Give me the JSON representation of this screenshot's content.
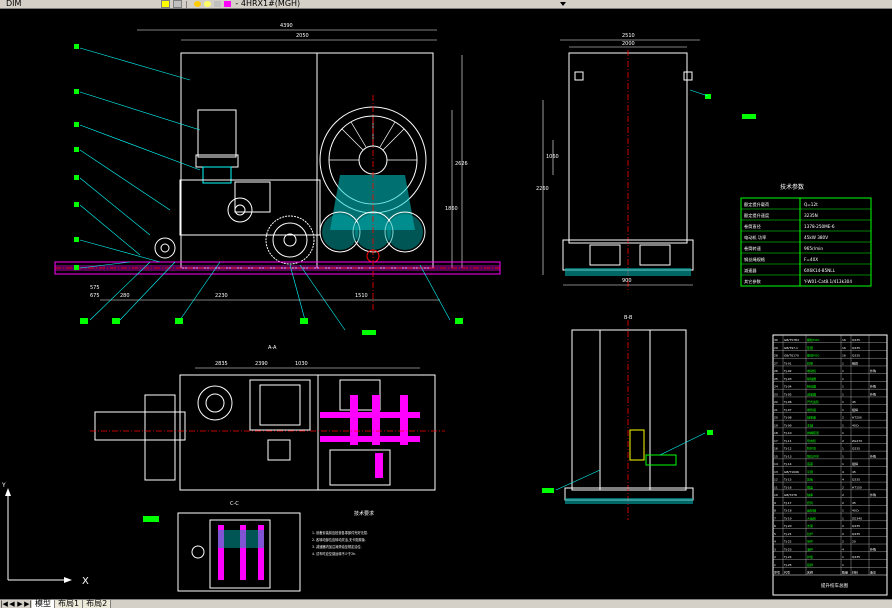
{
  "toolbar": {
    "left_text": "DIM",
    "title_text": "- 4HRX1#(MGH)"
  },
  "tabs": {
    "items": [
      "模型",
      "布局1",
      "布局2"
    ],
    "nav": [
      "|◀",
      "◀",
      "▶",
      "▶|"
    ]
  },
  "ucs": {
    "x_label": "X",
    "y_label": "Y"
  },
  "dimensions": {
    "front_overall": "4390",
    "front_sub": "2050",
    "front_height": "2626",
    "front_height2": "1860",
    "front_base_a": "280",
    "front_base_b": "2230",
    "front_base_c": "1510",
    "front_base_d": "575",
    "front_base_e": "675",
    "side_top": "2510",
    "side_top2": "2000",
    "side_height": "2260",
    "side_height2": "1060",
    "side_base": "900",
    "plan_a": "2835",
    "plan_b": "2390",
    "plan_c": "1030"
  },
  "section_labels": {
    "plan": "A-A",
    "section_bb": "B-B",
    "detail_c": "C-C"
  },
  "spec_table": {
    "title": "技术参数",
    "rows": [
      [
        "额定提升载荷",
        "Q=12t"
      ],
      [
        "额定提升速度",
        "3235N"
      ],
      [
        "卷筒直径",
        "1378-250ME-6"
      ],
      [
        "电动机 功率",
        "45kW  380V"
      ],
      [
        "卷筒转速",
        "965r/min"
      ],
      [
        "钢丝绳规格",
        "F=40X"
      ],
      [
        "减速器",
        "6X6K14-85NLL"
      ],
      [
        "其它参数",
        "Y-W01-Cat8.1/413k304"
      ]
    ]
  },
  "notes": {
    "title": "技术要求",
    "lines": [
      "1. 设备安装前应检查各零部件完好无损.",
      "2. 各转动部位应转动灵活,无卡阻现象.",
      "3. 减速器内加注润滑油至规定油位.",
      "4. 试车时应空载运转不少于2h."
    ]
  },
  "parts_list": {
    "header": [
      "序号",
      "代号",
      "名称",
      "数量",
      "材料",
      "备注"
    ],
    "rows": [
      [
        "30",
        "GB/T5783",
        "螺栓M20",
        "16",
        "Q235",
        ""
      ],
      [
        "29",
        "GB/T97.1",
        "垫圈",
        "16",
        "Q235",
        ""
      ],
      [
        "28",
        "GB/T6170",
        "螺母M20",
        "16",
        "Q235",
        ""
      ],
      [
        "27",
        "TJ-01",
        "机架",
        "1",
        "组焊",
        ""
      ],
      [
        "26",
        "TJ-02",
        "电动机",
        "1",
        "",
        "外购"
      ],
      [
        "25",
        "TJ-03",
        "联轴器",
        "1",
        "",
        ""
      ],
      [
        "24",
        "TJ-04",
        "制动器",
        "1",
        "",
        "外购"
      ],
      [
        "23",
        "TJ-05",
        "减速器",
        "1",
        "",
        "外购"
      ],
      [
        "22",
        "TJ-06",
        "开式齿轮",
        "1",
        "45",
        ""
      ],
      [
        "21",
        "TJ-07",
        "卷筒组",
        "1",
        "组焊",
        ""
      ],
      [
        "20",
        "TJ-08",
        "轴承座",
        "2",
        "HT200",
        ""
      ],
      [
        "19",
        "TJ-09",
        "主轴",
        "1",
        "40Cr",
        ""
      ],
      [
        "18",
        "TJ-10",
        "排绳装置",
        "1",
        "",
        ""
      ],
      [
        "17",
        "TJ-11",
        "导向轮",
        "2",
        "ZG270",
        ""
      ],
      [
        "16",
        "TJ-12",
        "防护罩",
        "1",
        "Q235",
        ""
      ],
      [
        "15",
        "TJ-13",
        "限位开关",
        "1",
        "",
        "外购"
      ],
      [
        "14",
        "TJ-14",
        "底座",
        "1",
        "组焊",
        ""
      ],
      [
        "13",
        "GB/T1096",
        "平键",
        "4",
        "45",
        ""
      ],
      [
        "12",
        "TJ-15",
        "压板",
        "4",
        "Q235",
        ""
      ],
      [
        "11",
        "TJ-16",
        "端盖",
        "2",
        "HT150",
        ""
      ],
      [
        "10",
        "GB/T276",
        "轴承",
        "2",
        "",
        "外购"
      ],
      [
        "9",
        "TJ-17",
        "套筒",
        "2",
        "45",
        ""
      ],
      [
        "8",
        "TJ-18",
        "齿轮轴",
        "1",
        "40Cr",
        ""
      ],
      [
        "7",
        "TJ-19",
        "大齿轮",
        "1",
        "ZG340",
        ""
      ],
      [
        "6",
        "TJ-20",
        "支架",
        "2",
        "Q235",
        ""
      ],
      [
        "5",
        "TJ-21",
        "拉杆",
        "2",
        "Q235",
        ""
      ],
      [
        "4",
        "TJ-22",
        "吊环",
        "2",
        "20",
        ""
      ],
      [
        "3",
        "TJ-23",
        "油杯",
        "4",
        "",
        "外购"
      ],
      [
        "2",
        "TJ-24",
        "护板",
        "1",
        "Q235",
        ""
      ],
      [
        "1",
        "TJ-25",
        "铭牌",
        "1",
        "",
        ""
      ]
    ],
    "footer": [
      "提升绞车总图"
    ]
  },
  "leader_numbers": [
    "1",
    "2",
    "3",
    "4",
    "5",
    "6",
    "7",
    "8",
    "9",
    "10",
    "11",
    "12",
    "13",
    "14"
  ],
  "colors": {
    "background": "#000000",
    "line_white": "#ffffff",
    "line_cyan": "#00ffff",
    "line_magenta": "#ff00ff",
    "line_green": "#00ff00",
    "line_red": "#ff0000",
    "line_yellow": "#ffff00"
  }
}
